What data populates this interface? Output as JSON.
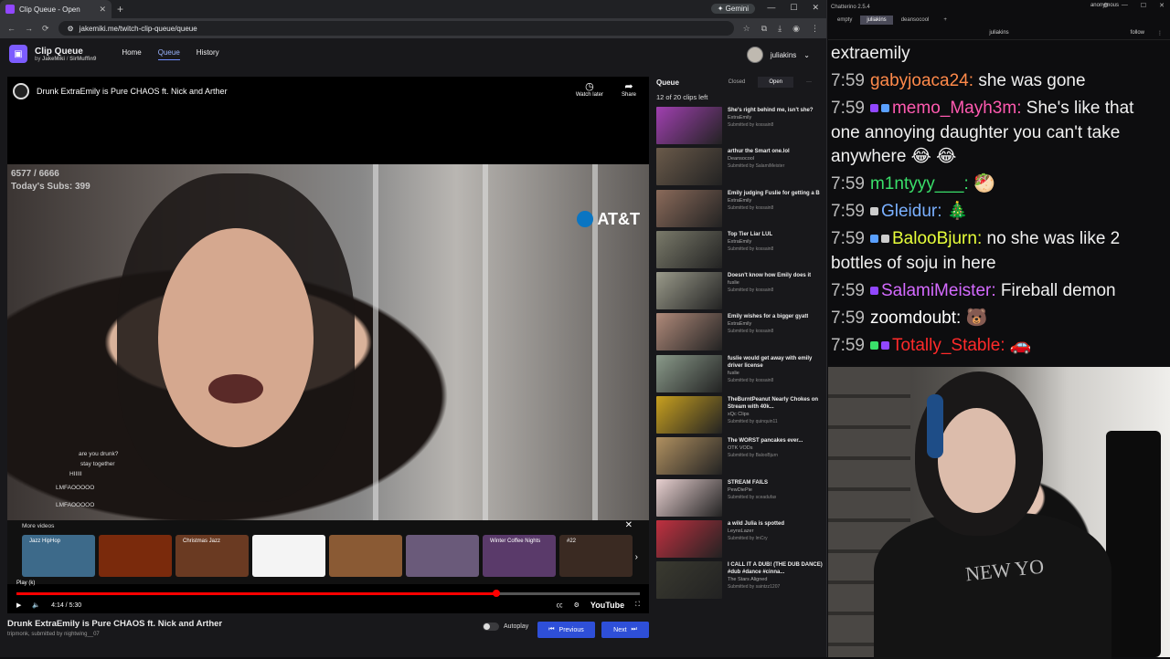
{
  "browser": {
    "tab_title": "Clip Queue - Open",
    "new_tab": "+",
    "gemini_label": "Gemini",
    "url": "jakemiki.me/twitch-clip-queue/queue"
  },
  "app": {
    "title": "Clip Queue",
    "by_prefix": "by",
    "author1": "JakeMiki",
    "author2": "SirMuffin9",
    "nav": [
      "Home",
      "Queue",
      "History"
    ],
    "username": "juliakins"
  },
  "player": {
    "video_title": "Drunk ExtraEmily is Pure CHAOS ft. Nick and Arther",
    "watch_later": "Watch later",
    "share": "Share",
    "subs_count": "6577 / 6666",
    "subs_today": "Today's Subs: 399",
    "att": "AT&T",
    "onscreen_chat": [
      "are you drunk?",
      "stay together",
      "HIIIII",
      "LMFAOOOOO",
      "LMFAOOOOO"
    ],
    "more_videos_label": "More videos",
    "more_thumbs": [
      {
        "label": "Jazz HipHop",
        "color": "#3d6a8a"
      },
      {
        "label": "",
        "color": "#7a2a0c"
      },
      {
        "label": "Christmas Jazz",
        "color": "#6a3a22"
      },
      {
        "label": "",
        "color": "#f4f4f4"
      },
      {
        "label": "",
        "color": "#8a5a34"
      },
      {
        "label": "",
        "color": "#6a5a7a"
      },
      {
        "label": "Winter Coffee Nights",
        "color": "#5a3a6a"
      },
      {
        "label": "#22",
        "color": "#3a2a22"
      }
    ],
    "play_tooltip": "Play (k)",
    "time": "4:14 / 5:30",
    "progress": 0.77,
    "youtube_label": "YouTube"
  },
  "below": {
    "title": "Drunk ExtraEmily is Pure CHAOS ft. Nick and Arther",
    "meta_channel": "tripmonk",
    "meta_submitted": "submitted by",
    "meta_user": "nightwing__07",
    "autoplay": "Autoplay",
    "previous": "Previous",
    "next": "Next"
  },
  "queue": {
    "title": "Queue",
    "tab_closed": "Closed",
    "tab_open": "Open",
    "more": "···",
    "count": "12 of 20 clips left",
    "items": [
      {
        "title": "She's right behind me, isn't she?",
        "channel": "ExtraEmily",
        "submitter": "Submitted by kossain8",
        "color": "#a040b0"
      },
      {
        "title": "arthur the Smart one.lol",
        "channel": "Deansocool",
        "submitter": "Submitted by SalamiMeister",
        "color": "#6a5a4a"
      },
      {
        "title": "Emily judging Fuslie for getting a B",
        "channel": "ExtraEmily",
        "submitter": "Submitted by kossain8",
        "color": "#8a6a5a"
      },
      {
        "title": "Top Tier Liar LUL",
        "channel": "ExtraEmily",
        "submitter": "Submitted by kossain8",
        "color": "#7a7a6a"
      },
      {
        "title": "Doesn't know how Emily does it",
        "channel": "fuslie",
        "submitter": "Submitted by kossain8",
        "color": "#9a9a8a"
      },
      {
        "title": "Emily wishes for a bigger gyatt",
        "channel": "ExtraEmily",
        "submitter": "Submitted by kossain8",
        "color": "#b08a7a"
      },
      {
        "title": "fuslie would get away with emily driver license",
        "channel": "fuslie",
        "submitter": "Submitted by kossain8",
        "color": "#8a9a8a"
      },
      {
        "title": "TheBurntPeanut Nearly Chokes on Stream with 40k...",
        "channel": "xQc Clips",
        "submitter": "Submitted by quinquin11",
        "color": "#c8a020"
      },
      {
        "title": "The WORST pancakes ever...",
        "channel": "OTK VODs",
        "submitter": "Submitted by BalooBjurn",
        "color": "#b09060"
      },
      {
        "title": "STREAM FAILS",
        "channel": "PewDiePie",
        "submitter": "Submitted by sceadufax",
        "color": "#e8d0d0"
      },
      {
        "title": "a wild Julia is spotted",
        "channel": "LeynsLazer",
        "submitter": "Submitted by lmCry",
        "color": "#c03040"
      },
      {
        "title": "I CALL IT A DUB! (THE DUB DANCE) #dub #dance #cinna...",
        "channel": "The Stars Aligned",
        "submitter": "Submitted by saintzz1207",
        "color": "#3a3a30"
      }
    ]
  },
  "chatterino": {
    "window_title": "Chatterino 2.5.4",
    "account": "anonymous",
    "tabs": [
      "empty",
      "juliakins",
      "deansocool"
    ],
    "add_tab": "+",
    "channel": "juliakins",
    "follow": "follow",
    "first_line": "extraemily",
    "messages": [
      {
        "time": "7:59",
        "user": "gabyjoaca24",
        "color": "#ff8a4a",
        "text": "she was gone",
        "badges": []
      },
      {
        "time": "7:59",
        "user": "memo_Mayh3m",
        "color": "#ff5ab0",
        "text": "She's like that one annoying daughter you can't take anywhere 😂 😂",
        "badges": [
          "#9147ff",
          "#5aa0ff"
        ]
      },
      {
        "time": "7:59",
        "user": "m1ntyyy___",
        "color": "#3adf6a",
        "text": "🥙",
        "badges": []
      },
      {
        "time": "7:59",
        "user": "Gleidur",
        "color": "#7ab0ff",
        "text": "🎄",
        "badges": [
          "#cccccc"
        ]
      },
      {
        "time": "7:59",
        "user": "BalooBjurn",
        "color": "#e8ff3a",
        "text": "no she was like 2 bottles of soju in here",
        "badges": [
          "#5aa0ff",
          "#cccccc"
        ]
      },
      {
        "time": "7:59",
        "user": "SalamiMeister",
        "color": "#d46aff",
        "text": "Fireball demon",
        "badges": [
          "#9147ff"
        ]
      },
      {
        "time": "7:59",
        "user": "zoomdoubt",
        "color": "#ffffff",
        "text": "🐻",
        "badges": []
      },
      {
        "time": "7:59",
        "user": "Totally_Stable",
        "color": "#ff2a2a",
        "text": "🚗",
        "badges": [
          "#3adf6a",
          "#9147ff"
        ]
      }
    ]
  },
  "webcam": {
    "shirt_text": "NEW YO"
  },
  "colors": {
    "accent": "#2e4fd8",
    "progress": "#ff0000",
    "brand": "#7c5cff"
  }
}
